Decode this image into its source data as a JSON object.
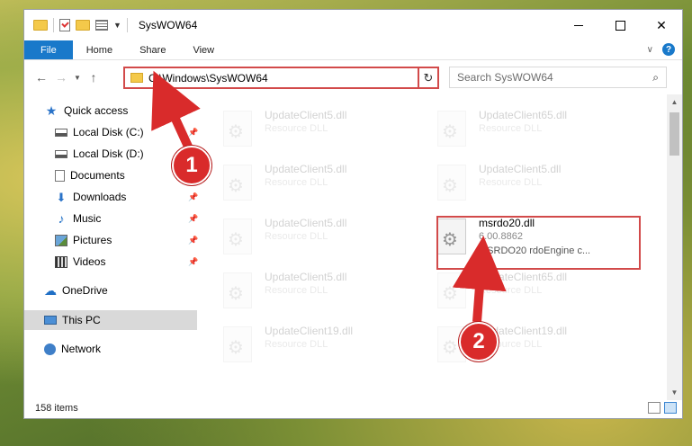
{
  "window": {
    "title": "SysWOW64",
    "accent": "#1979ca",
    "highlight_color": "#d24a4a"
  },
  "ribbon": {
    "tabs": [
      {
        "label": "File"
      },
      {
        "label": "Home"
      },
      {
        "label": "Share"
      },
      {
        "label": "View"
      }
    ],
    "help_label": "?"
  },
  "address": {
    "path": "C:\\Windows\\SysWOW64",
    "search_placeholder": "Search SysWOW64"
  },
  "nav": {
    "items": [
      {
        "label": "Quick access",
        "icon": "star-icon"
      },
      {
        "label": "Local Disk (C:)",
        "icon": "drive-icon",
        "pinned": true
      },
      {
        "label": "Local Disk (D:)",
        "icon": "drive-icon",
        "pinned": true
      },
      {
        "label": "Documents",
        "icon": "documents-icon",
        "pinned": true
      },
      {
        "label": "Downloads",
        "icon": "downloads-icon",
        "pinned": true
      },
      {
        "label": "Music",
        "icon": "music-icon",
        "pinned": true
      },
      {
        "label": "Pictures",
        "icon": "pictures-icon",
        "pinned": true
      },
      {
        "label": "Videos",
        "icon": "videos-icon",
        "pinned": true
      },
      {
        "label": "OneDrive",
        "icon": "cloud-icon"
      },
      {
        "label": "This PC",
        "icon": "pc-icon",
        "selected": true
      },
      {
        "label": "Network",
        "icon": "network-icon"
      }
    ]
  },
  "files": [
    {
      "name": "UpdateClient5.dll",
      "type": "Resource DLL",
      "faded": true
    },
    {
      "name": "UpdateClient65.dll",
      "type": "Resource DLL",
      "faded": true
    },
    {
      "name": "UpdateClient5.dll",
      "type": "Resource DLL",
      "faded": true
    },
    {
      "name": "UpdateClient5.dll",
      "type": "Resource DLL",
      "faded": true
    },
    {
      "name": "UpdateClient5.dll",
      "type": "Resource DLL",
      "faded": true
    },
    {
      "name": "msrdo20.dll",
      "version": "6.00.8862",
      "description": "MSRDO20 rdoEngine c...",
      "faded": false
    },
    {
      "name": "UpdateClient5.dll",
      "type": "Resource DLL",
      "faded": true
    },
    {
      "name": "UpdateClient65.dll",
      "type": "Resource DLL",
      "faded": true
    },
    {
      "name": "UpdateClient19.dll",
      "type": "Resource DLL",
      "faded": true
    },
    {
      "name": "UpdateClient19.dll",
      "type": "Resource DLL",
      "faded": true
    }
  ],
  "status": {
    "count": "158 items"
  },
  "callouts": {
    "one": "1",
    "two": "2"
  }
}
